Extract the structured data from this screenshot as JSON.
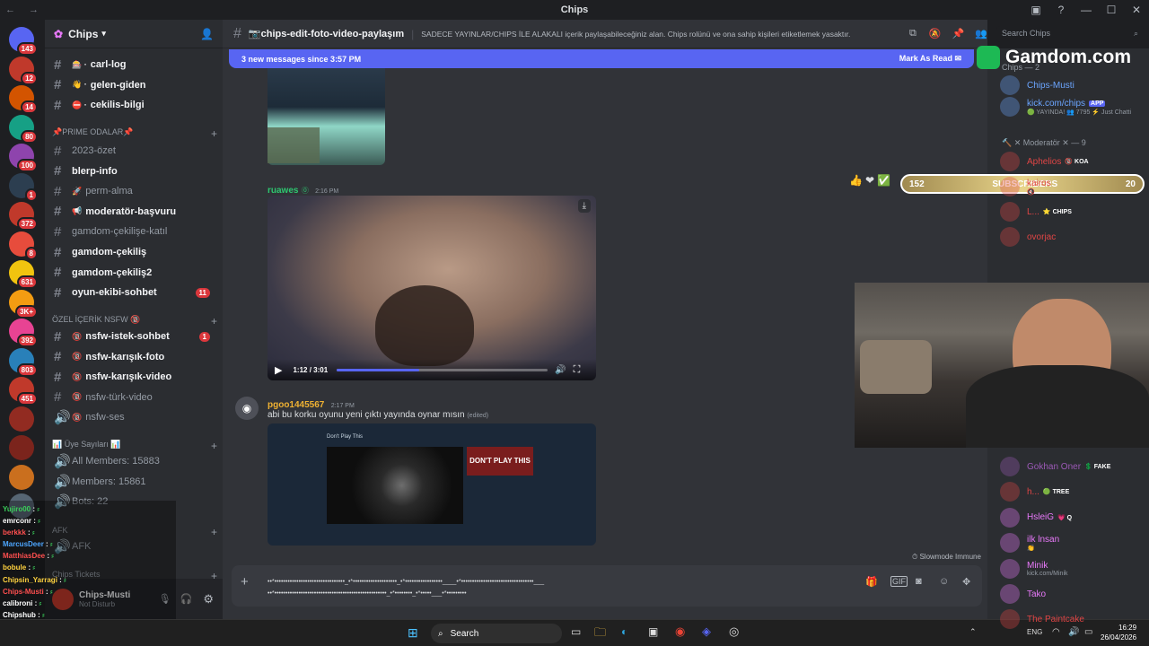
{
  "window": {
    "title": "Chips",
    "nav": "← →",
    "controls": [
      "▣",
      "?",
      "—",
      "☐",
      "✕"
    ]
  },
  "rail": {
    "badges": [
      "143",
      "12",
      "14",
      "80",
      "100",
      "1",
      "372",
      "8",
      "631",
      "3K+",
      "392",
      "803",
      "451"
    ]
  },
  "sidebar": {
    "guild": "Chips",
    "channels_top": [
      {
        "name": "carl-log",
        "icon": "🎰 ·"
      },
      {
        "name": "gelen-giden",
        "icon": "👋 ·"
      },
      {
        "name": "cekilis-bilgi",
        "icon": "⛔ ·"
      }
    ],
    "cat_prime": "📌PRIME ODALAR📌",
    "prime": [
      {
        "name": "2023-özet",
        "active": false
      },
      {
        "name": "blerp-info",
        "active": true
      },
      {
        "name": "perm-alma",
        "icon": "🚀",
        "active": false
      },
      {
        "name": "moderatör-başvuru",
        "icon": "📢",
        "active": true
      },
      {
        "name": "gamdom-çekilişe-katıl",
        "active": false
      },
      {
        "name": "gamdom-çekiliş",
        "active": true
      },
      {
        "name": "gamdom-çekiliş2",
        "active": true
      },
      {
        "name": "oyun-ekibi-sohbet",
        "active": true,
        "unread": "11"
      }
    ],
    "cat_nsfw": "ÖZEL İÇERİK NSFW 🔞",
    "nsfw": [
      {
        "name": "nsfw-istek-sohbet",
        "active": true,
        "unread": "1"
      },
      {
        "name": "nsfw-karışık-foto",
        "active": true
      },
      {
        "name": "nsfw-karışık-video",
        "active": true
      },
      {
        "name": "nsfw-türk-video",
        "active": false
      },
      {
        "name": "nsfw-ses",
        "active": false,
        "voice": true
      }
    ],
    "cat_stats": "📊 Üye Sayıları 📊",
    "stats": [
      "All Members: 15883",
      "Members: 15861",
      "Bots: 22"
    ],
    "cat_afk": "AFK",
    "afk": "AFK",
    "cat_tickets": "Chips Tickets"
  },
  "user": {
    "name": "Chips-Musti",
    "status": "Not Disturb"
  },
  "overlay_chat": [
    {
      "n": "Yujiro00",
      "c": "#3ad05a"
    },
    {
      "n": "emrconr",
      "c": "#ffffff"
    },
    {
      "n": "berkkk",
      "c": "#ff4f4f"
    },
    {
      "n": "MarcusDeer",
      "c": "#4da6ff"
    },
    {
      "n": "MatthiasDee",
      "c": "#ff4f4f"
    },
    {
      "n": "bobule",
      "c": "#ffd23f"
    },
    {
      "n": "Chipsin_Yarragi",
      "c": "#ffd23f"
    },
    {
      "n": "Chips-Musti",
      "c": "#ff4f4f"
    },
    {
      "n": "calibroni",
      "c": "#ffffff"
    },
    {
      "n": "Chipshub",
      "c": "#ffffff"
    },
    {
      "n": "TheSelo",
      "c": "#4da6ff"
    }
  ],
  "channel": {
    "name": "📷chips-edit-foto-video-paylaşım",
    "topic": "SADECE YAYINLAR/CHIPS İLE ALAKALI içerik paylaşabileceğiniz alan. Chips rolünü ve ona sahip kişileri etiketlemek yasaktır.",
    "search": "Search Chips"
  },
  "newbar": {
    "text": "3 new messages since 3:57 PM",
    "action": "Mark As Read"
  },
  "msgs": [
    {
      "user": "ruawes",
      "time": "2:16 PM",
      "color": "#2dc770",
      "video_time": "1:12 / 3:01",
      "video_progress": 0.39
    },
    {
      "user": "pgoo1445567",
      "time": "2:17 PM",
      "color": "#f0b232",
      "text": "abi bu korku oyunu yeni çıktı yayında oynar mısın",
      "edited": "(edited)",
      "shot_title": "Don't Play This",
      "shot_cover": "DON'T PLAY THIS"
    }
  ],
  "slowmode": "Slowmode Immune",
  "composer": {
    "line1": "••*••••••••••••••••••••••••••••••••_•*••••••••••••••••••••_•*•••••••••••••••••____•*•••••••••••••••••••••••••••••••••___",
    "line2": "••*•••••••••••••••••••••••••••••••••••••••••••••••••••_•*••••••••_•*•••••___•*•••••••••"
  },
  "members": {
    "cat_chips": "Chips — 2",
    "chips": [
      {
        "n": "Chips-Musti",
        "c": "#6ba5ff"
      },
      {
        "n": "kick.com/chips",
        "c": "#6ba5ff",
        "tag": "APP",
        "sub": "🟢 YAYINDA! 👥 7795 ⚡ Just Chatti"
      }
    ],
    "cat_mod": "🔨 ✕ Moderatör ✕ — 9",
    "mods": [
      {
        "n": "Aphelios",
        "c": "#e04545",
        "tag": "🔞 KOA"
      },
      {
        "n": "kairos",
        "c": "#e04545",
        "sub": "🔇"
      },
      {
        "n": "L...",
        "c": "#e04545",
        "tag": "⭐ CHIPS"
      },
      {
        "n": "ovorjac",
        "c": "#e04545"
      }
    ],
    "others": [
      {
        "n": "Gokhan Oner",
        "c": "#9b59b6",
        "tag": "💲 FAKE"
      },
      {
        "n": "h...",
        "c": "#e04545",
        "tag": "🟢 TREE"
      },
      {
        "n": "HsleiG",
        "c": "#e879f9",
        "tag": "💗 Q"
      },
      {
        "n": "ilk lnsan",
        "c": "#e879f9",
        "sub": "👏"
      },
      {
        "n": "Minik",
        "c": "#e879f9",
        "sub": "kick.com/Minik"
      },
      {
        "n": "Tako",
        "c": "#e879f9"
      },
      {
        "n": "The Paintcake",
        "c": "#e04545"
      }
    ]
  },
  "stream": {
    "brand": "Gamdom.com",
    "subs_left": "152",
    "subs_label": "SUBSCRIBERS",
    "subs_right": "20"
  },
  "taskbar": {
    "search": "Search",
    "lang": "ENG",
    "time": "16:29",
    "date": "26/04/2026"
  }
}
